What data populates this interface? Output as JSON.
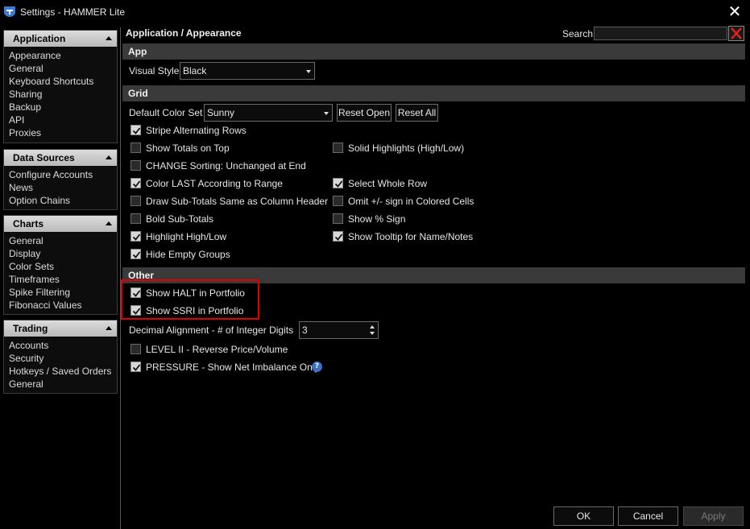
{
  "window": {
    "title": "Settings - HAMMER Lite"
  },
  "sidebar": {
    "groups": [
      {
        "title": "Application",
        "items": [
          "Appearance",
          "General",
          "Keyboard Shortcuts",
          "Sharing",
          "Backup",
          "API",
          "Proxies"
        ]
      },
      {
        "title": "Data Sources",
        "items": [
          "Configure Accounts",
          "News",
          "Option Chains"
        ]
      },
      {
        "title": "Charts",
        "items": [
          "General",
          "Display",
          "Color Sets",
          "Timeframes",
          "Spike Filtering",
          "Fibonacci Values"
        ]
      },
      {
        "title": "Trading",
        "items": [
          "Accounts",
          "Security",
          "Hotkeys / Saved Orders",
          "General"
        ]
      }
    ]
  },
  "main": {
    "breadcrumb": "Application / Appearance",
    "search": {
      "label": "Search",
      "value": ""
    },
    "app_section": {
      "title": "App",
      "visual_style_label": "Visual Style",
      "visual_style_value": "Black"
    },
    "grid_section": {
      "title": "Grid",
      "default_color_set_label": "Default Color Set",
      "default_color_set_value": "Sunny",
      "reset_open": "Reset Open",
      "reset_all": "Reset All",
      "left_options": [
        {
          "label": "Stripe Alternating Rows",
          "checked": true
        },
        {
          "label": "Show Totals on Top",
          "checked": false
        },
        {
          "label": "CHANGE Sorting: Unchanged at End",
          "checked": false
        },
        {
          "label": "Color LAST According to Range",
          "checked": true
        },
        {
          "label": "Draw Sub-Totals Same as Column Header",
          "checked": false
        },
        {
          "label": "Bold Sub-Totals",
          "checked": false
        },
        {
          "label": "Highlight High/Low",
          "checked": true
        },
        {
          "label": "Hide Empty Groups",
          "checked": true
        }
      ],
      "right_options": [
        {
          "label": "Solid Highlights (High/Low)",
          "checked": false
        },
        {
          "label": "Select Whole Row",
          "checked": true
        },
        {
          "label": "Omit +/- sign in Colored Cells",
          "checked": false
        },
        {
          "label": "Show % Sign",
          "checked": false
        },
        {
          "label": "Show Tooltip for Name/Notes",
          "checked": true
        }
      ]
    },
    "other_section": {
      "title": "Other",
      "show_halt": {
        "label": "Show HALT in Portfolio",
        "checked": true
      },
      "show_ssri": {
        "label": "Show SSRI in Portfolio",
        "checked": true
      },
      "decimal_label": "Decimal Alignment - # of Integer Digits",
      "decimal_value": "3",
      "level2": {
        "label": "LEVEL II - Reverse Price/Volume",
        "checked": false
      },
      "pressure": {
        "label": "PRESSURE - Show Net Imbalance Only",
        "checked": true
      }
    }
  },
  "footer": {
    "ok": "OK",
    "cancel": "Cancel",
    "apply": "Apply"
  },
  "colors": {
    "highlight_border": "#e00000",
    "section_bg": "#3a3a3a",
    "header_bg": "#c8c8c8"
  }
}
